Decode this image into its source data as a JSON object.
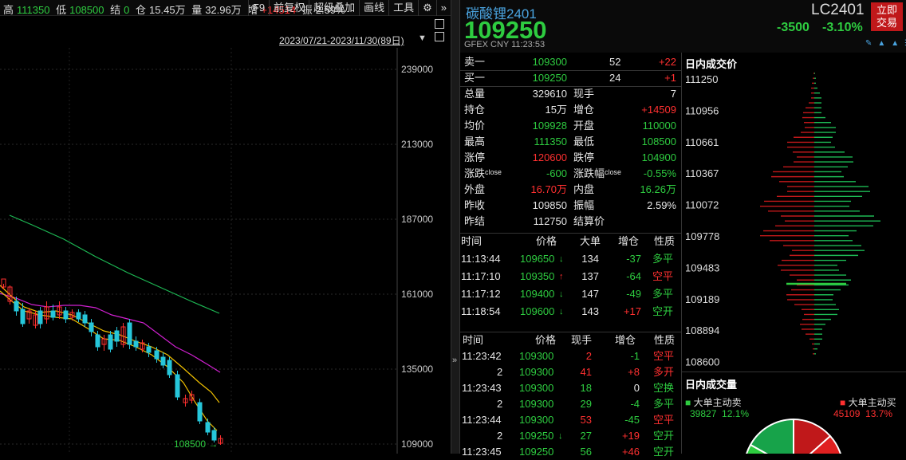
{
  "stats": {
    "high_label": "高",
    "high": "111350",
    "low_label": "低",
    "low": "108500",
    "settle_label": "结",
    "settle": "0",
    "pos_label": "仓",
    "pos": "15.45万",
    "vol_label": "量",
    "vol": "32.96万",
    "inc_label": "增",
    "inc": "+14514",
    "amp_label": "振",
    "amp": "2.59%"
  },
  "toolbar": [
    "F9",
    "前复权",
    "超级叠加",
    "画线",
    "工具",
    "⚙",
    "»"
  ],
  "date_range": "2023/07/21-2023/11/30(89日)",
  "chart": {
    "y_ticks": [
      "239000",
      "213000",
      "187000",
      "161000",
      "135000",
      "109000"
    ],
    "low_marker": "108500"
  },
  "header": {
    "name": "碳酸锂2401",
    "price": "109250",
    "meta": "GFEX  CNY  11:23:53",
    "code": "LC2401",
    "change": "-3500",
    "pct": "-3.10%",
    "trade_btn_1": "立即",
    "trade_btn_2": "交易"
  },
  "quote": [
    [
      {
        "t": "卖一",
        "c": "w"
      },
      {
        "t": "109300",
        "c": "g"
      },
      {
        "t": "52",
        "c": "w"
      },
      {
        "t": "+22",
        "c": "r"
      }
    ],
    [
      {
        "t": "买一",
        "c": "w"
      },
      {
        "t": "109250",
        "c": "g"
      },
      {
        "t": "24",
        "c": "w"
      },
      {
        "t": "+1",
        "c": "r"
      }
    ],
    [
      {
        "t": "总量",
        "c": "w"
      },
      {
        "t": "329610",
        "c": "w"
      },
      {
        "t": "现手",
        "c": "w"
      },
      {
        "t": "7",
        "c": "w"
      }
    ],
    [
      {
        "t": "持仓",
        "c": "w"
      },
      {
        "t": "15万",
        "c": "w"
      },
      {
        "t": "增仓",
        "c": "w"
      },
      {
        "t": "+14509",
        "c": "r"
      }
    ],
    [
      {
        "t": "均价",
        "c": "w"
      },
      {
        "t": "109928",
        "c": "g"
      },
      {
        "t": "开盘",
        "c": "w"
      },
      {
        "t": "110000",
        "c": "g"
      }
    ],
    [
      {
        "t": "最高",
        "c": "w"
      },
      {
        "t": "111350",
        "c": "g"
      },
      {
        "t": "最低",
        "c": "w"
      },
      {
        "t": "108500",
        "c": "g"
      }
    ],
    [
      {
        "t": "涨停",
        "c": "w"
      },
      {
        "t": "120600",
        "c": "r"
      },
      {
        "t": "跌停",
        "c": "w"
      },
      {
        "t": "104900",
        "c": "g"
      }
    ],
    [
      {
        "t": "涨跌ᶜˡᵒˢᵉ",
        "c": "w"
      },
      {
        "t": "-600",
        "c": "g"
      },
      {
        "t": "涨跌幅ᶜˡᵒˢᵉ",
        "c": "w"
      },
      {
        "t": "-0.55%",
        "c": "g"
      }
    ],
    [
      {
        "t": "外盘",
        "c": "w"
      },
      {
        "t": "16.70万",
        "c": "r"
      },
      {
        "t": "内盘",
        "c": "w"
      },
      {
        "t": "16.26万",
        "c": "g"
      }
    ],
    [
      {
        "t": "昨收",
        "c": "w"
      },
      {
        "t": "109850",
        "c": "w"
      },
      {
        "t": "振幅",
        "c": "w"
      },
      {
        "t": "2.59%",
        "c": "w"
      }
    ],
    [
      {
        "t": "昨结",
        "c": "w"
      },
      {
        "t": "112750",
        "c": "w"
      },
      {
        "t": "结算价",
        "c": "w"
      },
      {
        "t": "",
        "c": "w"
      }
    ]
  ],
  "big_trades": {
    "headers": [
      "时间",
      "价格",
      "大单",
      "增仓",
      "性质"
    ],
    "rows": [
      {
        "time": "11:13:44",
        "price": "109650",
        "arrow": "↓",
        "ac": "g",
        "qty": "134",
        "inc": "-37",
        "ic": "g",
        "nat": "多平",
        "nc": "g"
      },
      {
        "time": "11:17:10",
        "price": "109350",
        "arrow": "↑",
        "ac": "r",
        "qty": "137",
        "inc": "-64",
        "ic": "g",
        "nat": "空平",
        "nc": "r"
      },
      {
        "time": "11:17:12",
        "price": "109400",
        "arrow": "↓",
        "ac": "g",
        "qty": "147",
        "inc": "-49",
        "ic": "g",
        "nat": "多平",
        "nc": "g"
      },
      {
        "time": "11:18:54",
        "price": "109600",
        "arrow": "↓",
        "ac": "g",
        "qty": "143",
        "inc": "+17",
        "ic": "r",
        "nat": "空开",
        "nc": "g"
      }
    ]
  },
  "ticks": {
    "headers": [
      "时间",
      "价格",
      "现手",
      "增仓",
      "性质"
    ],
    "rows": [
      {
        "time": "11:23:42",
        "price": "109300",
        "arrow": "",
        "qty": "2",
        "qc": "r",
        "inc": "-1",
        "ic": "g",
        "nat": "空平",
        "nc": "r"
      },
      {
        "time": "2",
        "price": "109300",
        "arrow": "",
        "qty": "41",
        "qc": "r",
        "inc": "+8",
        "ic": "r",
        "nat": "多开",
        "nc": "r"
      },
      {
        "time": "11:23:43",
        "price": "109300",
        "arrow": "",
        "qty": "18",
        "qc": "g",
        "inc": "0",
        "ic": "w",
        "nat": "空换",
        "nc": "g"
      },
      {
        "time": "2",
        "price": "109300",
        "arrow": "",
        "qty": "29",
        "qc": "g",
        "inc": "-4",
        "ic": "g",
        "nat": "多平",
        "nc": "g"
      },
      {
        "time": "11:23:44",
        "price": "109300",
        "arrow": "",
        "qty": "53",
        "qc": "r",
        "inc": "-45",
        "ic": "g",
        "nat": "空平",
        "nc": "r"
      },
      {
        "time": "2",
        "price": "109250",
        "arrow": "↓",
        "qty": "27",
        "qc": "g",
        "inc": "+19",
        "ic": "r",
        "nat": "空开",
        "nc": "g"
      },
      {
        "time": "11:23:45",
        "price": "109250",
        "arrow": "",
        "qty": "56",
        "qc": "g",
        "inc": "+46",
        "ic": "r",
        "nat": "空开",
        "nc": "g"
      }
    ]
  },
  "intraday": {
    "title": "日内成交价",
    "prices": [
      "111250",
      "110956",
      "110661",
      "110367",
      "110072",
      "109778",
      "109483",
      "109189",
      "108894",
      "108600"
    ]
  },
  "volume": {
    "title": "日内成交量",
    "sell_label": "大单主动卖",
    "sell_val": "39827",
    "sell_pct": "12.1%",
    "buy_label": "大单主动买",
    "buy_val": "45109",
    "buy_pct": "13.7%"
  }
}
